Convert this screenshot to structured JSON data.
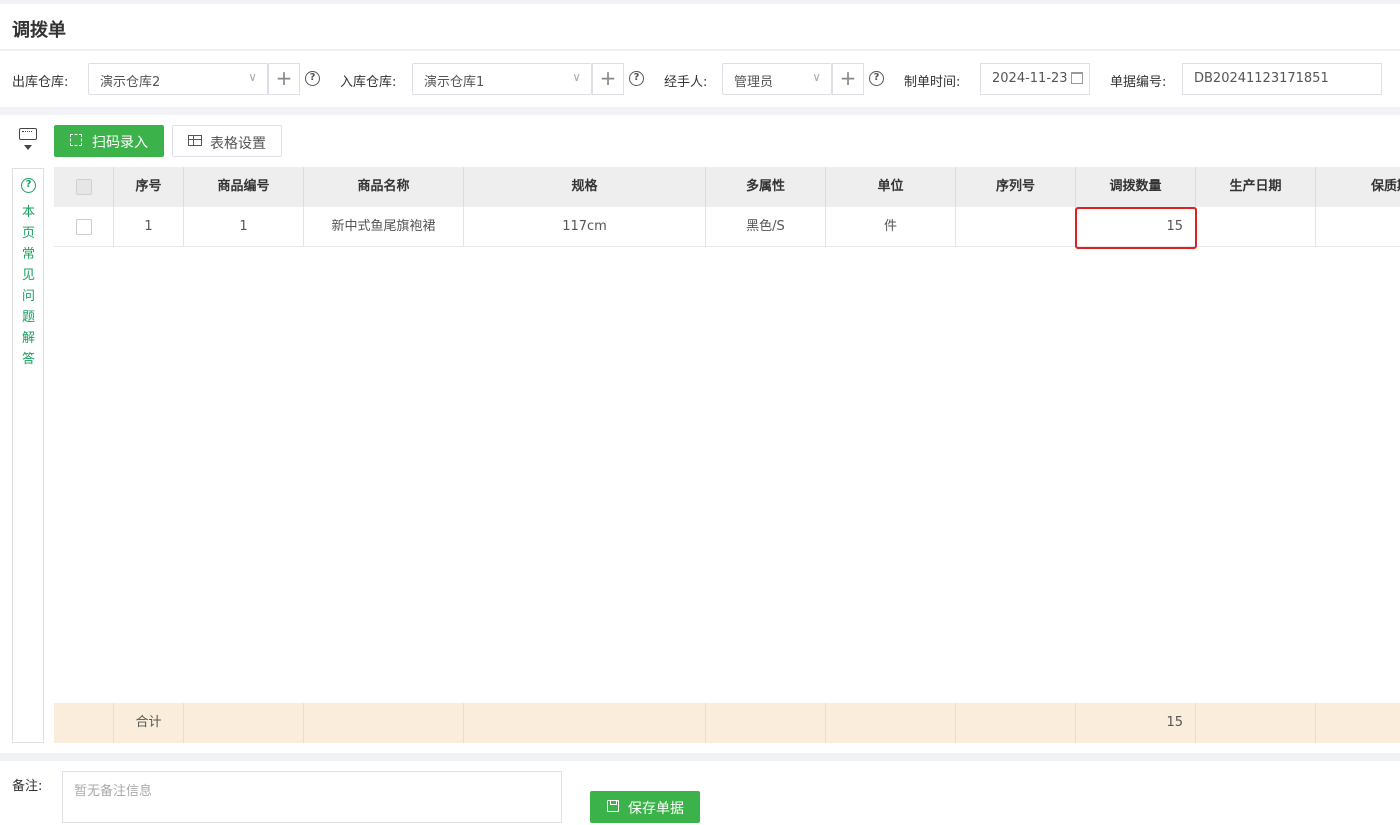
{
  "page": {
    "title": "调拨单"
  },
  "filters": {
    "out_warehouse_label": "出库仓库:",
    "out_warehouse_value": "演示仓库2",
    "in_warehouse_label": "入库仓库:",
    "in_warehouse_value": "演示仓库1",
    "handler_label": "经手人:",
    "handler_value": "管理员",
    "date_label": "制单时间:",
    "date_value": "2024-11-23",
    "docno_label": "单据编号:",
    "docno_value": "DB20241123171851",
    "plus_glyph": "+",
    "help_glyph": "?",
    "chevron_glyph": "∨"
  },
  "toolbar": {
    "scan_label": "扫码录入",
    "table_settings_label": "表格设置"
  },
  "faq": {
    "icon_glyph": "?",
    "label": "本页常见问题解答"
  },
  "table": {
    "headers": [
      "序号",
      "商品编号",
      "商品名称",
      "规格",
      "多属性",
      "单位",
      "序列号",
      "调拨数量",
      "生产日期",
      "保质期"
    ],
    "rows": [
      {
        "index": "1",
        "code": "1",
        "name": "新中式鱼尾旗袍裙",
        "spec": "117cm",
        "attrs": "黑色/S",
        "unit": "件",
        "serial": "",
        "quantity": "15",
        "production_date": "",
        "shelf_life": ""
      }
    ],
    "footer": {
      "label": "合计",
      "quantity_total": "15"
    }
  },
  "bottom": {
    "remarks_label": "备注:",
    "remarks_placeholder": "暂无备注信息",
    "save_label": "保存单据"
  },
  "colors": {
    "accent_green": "#3cb34a",
    "faq_green": "#19a15f",
    "highlight_red": "#e02020",
    "footer_bg": "#fbeddb"
  }
}
